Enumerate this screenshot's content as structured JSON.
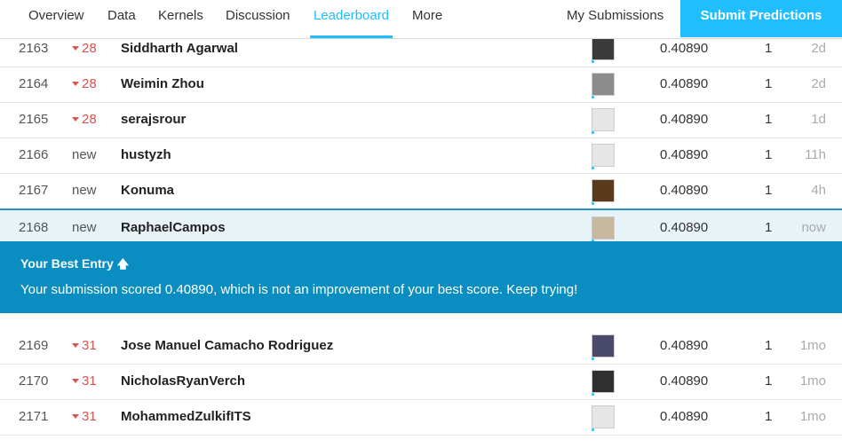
{
  "nav": {
    "tabs": [
      "Overview",
      "Data",
      "Kernels",
      "Discussion",
      "Leaderboard",
      "More"
    ],
    "my_submissions": "My Submissions",
    "submit_button": "Submit Predictions"
  },
  "rows": [
    {
      "rank": "2163",
      "change": "28",
      "name": "Siddharth Agarwal",
      "score": "0.40890",
      "entries": "1",
      "last": "2d",
      "avatar_color": "#3a3a3a"
    },
    {
      "rank": "2164",
      "change": "28",
      "name": "Weimin Zhou",
      "score": "0.40890",
      "entries": "1",
      "last": "2d",
      "avatar_color": "#8c8c8c"
    },
    {
      "rank": "2165",
      "change": "28",
      "name": "serajsrour",
      "score": "0.40890",
      "entries": "1",
      "last": "1d",
      "avatar_color": "#e6e6e6"
    },
    {
      "rank": "2166",
      "change": "new",
      "name": "hustyzh",
      "score": "0.40890",
      "entries": "1",
      "last": "11h",
      "avatar_color": "#e6e6e6"
    },
    {
      "rank": "2167",
      "change": "new",
      "name": "Konuma",
      "score": "0.40890",
      "entries": "1",
      "last": "4h",
      "avatar_color": "#5a3a1c"
    },
    {
      "rank": "2168",
      "change": "new",
      "name": "RaphaelCampos",
      "score": "0.40890",
      "entries": "1",
      "last": "now",
      "avatar_color": "#c8b8a0"
    }
  ],
  "banner": {
    "title": "Your Best Entry",
    "message": "Your submission scored 0.40890, which is not an improvement of your best score. Keep trying!"
  },
  "rows_after": [
    {
      "rank": "2169",
      "change": "31",
      "name": "Jose Manuel Camacho Rodriguez",
      "score": "0.40890",
      "entries": "1",
      "last": "1mo",
      "avatar_color": "#4a4a6a"
    },
    {
      "rank": "2170",
      "change": "31",
      "name": "NicholasRyanVerch",
      "score": "0.40890",
      "entries": "1",
      "last": "1mo",
      "avatar_color": "#2f2f2f"
    },
    {
      "rank": "2171",
      "change": "31",
      "name": "MohammedZulkifITS",
      "score": "0.40890",
      "entries": "1",
      "last": "1mo",
      "avatar_color": "#e6e6e6"
    }
  ],
  "colors": {
    "accent": "#20beff",
    "banner": "#0a8ec2",
    "drop": "#d9534f"
  }
}
